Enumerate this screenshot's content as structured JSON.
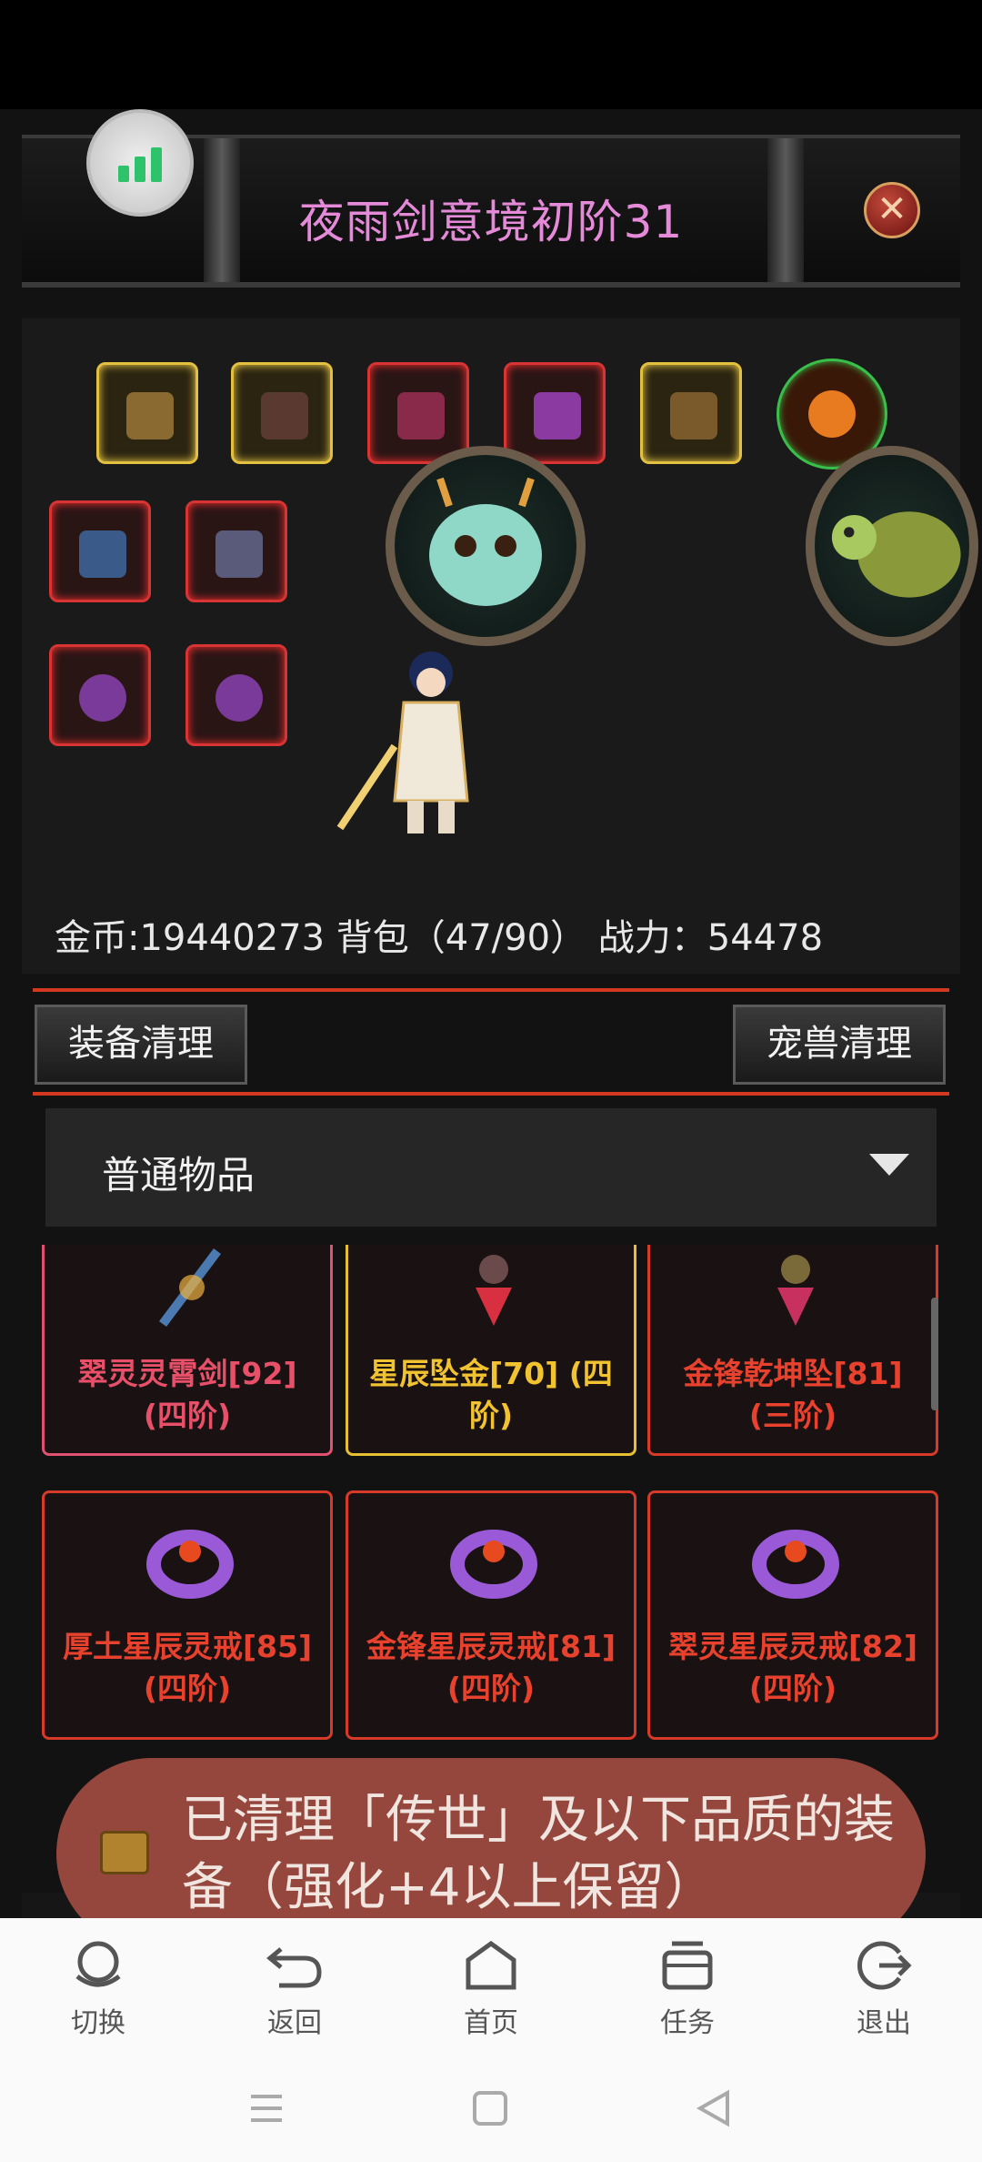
{
  "window": {
    "title": "夜雨剑意境初阶31"
  },
  "player": {
    "stats_line": "金币:19440273 背包（47/90） 战力：54478"
  },
  "actions": {
    "equip_clean": "装备清理",
    "pet_clean": "宠兽清理"
  },
  "filter": {
    "selected": "普通物品"
  },
  "items": [
    {
      "name": "翠灵灵霄剑[92] (四阶)",
      "color": "#e8506a"
    },
    {
      "name": "星辰坠金[70] (四阶)",
      "color": "#f2c330"
    },
    {
      "name": "金锋乾坤坠[81] (三阶)",
      "color": "#e8422e"
    },
    {
      "name": "厚土星辰灵戒[85] (四阶)",
      "color": "#e8422e"
    },
    {
      "name": "金锋星辰灵戒[81] (四阶)",
      "color": "#e8422e"
    },
    {
      "name": "翠灵星辰灵戒[82] (四阶)",
      "color": "#e8422e"
    }
  ],
  "toast": {
    "message": "已清理「传世」及以下品质的装备（强化+4以上保留）"
  },
  "bottom_nav": [
    {
      "label": "切换",
      "icon": "switch-icon"
    },
    {
      "label": "返回",
      "icon": "back-icon"
    },
    {
      "label": "首页",
      "icon": "home-icon"
    },
    {
      "label": "任务",
      "icon": "tasks-icon"
    },
    {
      "label": "退出",
      "icon": "exit-icon"
    }
  ],
  "colors": {
    "accent_red": "#d4391f",
    "active_tab": "#f5c518",
    "title_pink": "#e58ad8"
  }
}
